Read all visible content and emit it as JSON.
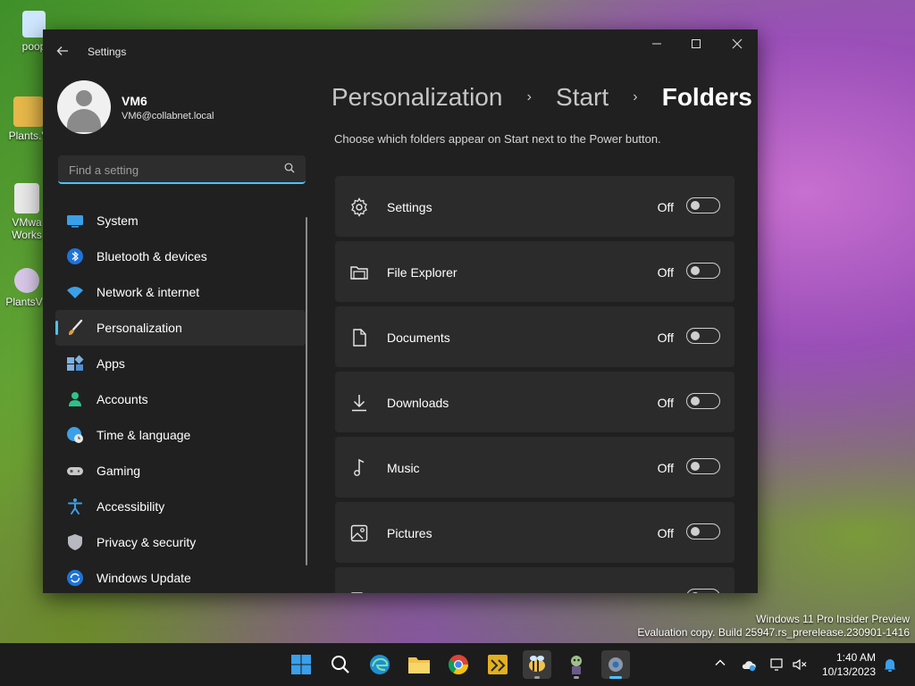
{
  "desktop": {
    "icons": [
      {
        "label": "poop"
      },
      {
        "label": "Plants.V"
      },
      {
        "label": "VMwa Works"
      },
      {
        "label": "PlantsVs"
      }
    ],
    "watermark_line1": "Windows 11 Pro Insider Preview",
    "watermark_line2": "Evaluation copy. Build 25947.rs_prerelease.230901-1416"
  },
  "window": {
    "title": "Settings",
    "back_icon": "arrow-left-icon",
    "controls": {
      "minimize": "—",
      "maximize": "☐",
      "close": "✕"
    }
  },
  "profile": {
    "name": "VM6",
    "email": "VM6@collabnet.local"
  },
  "search": {
    "placeholder": "Find a setting"
  },
  "sidebar": {
    "items": [
      {
        "label": "System",
        "icon": "monitor-icon"
      },
      {
        "label": "Bluetooth & devices",
        "icon": "bluetooth-icon"
      },
      {
        "label": "Network & internet",
        "icon": "wifi-icon"
      },
      {
        "label": "Personalization",
        "icon": "brush-icon",
        "active": true
      },
      {
        "label": "Apps",
        "icon": "apps-icon"
      },
      {
        "label": "Accounts",
        "icon": "person-icon"
      },
      {
        "label": "Time & language",
        "icon": "globe-clock-icon"
      },
      {
        "label": "Gaming",
        "icon": "gamepad-icon"
      },
      {
        "label": "Accessibility",
        "icon": "accessibility-icon"
      },
      {
        "label": "Privacy & security",
        "icon": "shield-icon"
      },
      {
        "label": "Windows Update",
        "icon": "update-icon"
      }
    ]
  },
  "breadcrumb": {
    "items": [
      "Personalization",
      "Start",
      "Folders"
    ],
    "separator": "›"
  },
  "description": "Choose which folders appear on Start next to the Power button.",
  "folders": [
    {
      "label": "Settings",
      "state": "Off",
      "icon": "gear-icon"
    },
    {
      "label": "File Explorer",
      "state": "Off",
      "icon": "folder-icon"
    },
    {
      "label": "Documents",
      "state": "Off",
      "icon": "document-icon"
    },
    {
      "label": "Downloads",
      "state": "Off",
      "icon": "download-icon"
    },
    {
      "label": "Music",
      "state": "Off",
      "icon": "music-note-icon"
    },
    {
      "label": "Pictures",
      "state": "Off",
      "icon": "picture-icon"
    }
  ],
  "taskbar": {
    "clock_time": "1:40 AM",
    "clock_date": "10/13/2023",
    "colors": {
      "accent": "#4cc2ff",
      "panel": "#202020",
      "card": "#2b2b2b"
    }
  }
}
